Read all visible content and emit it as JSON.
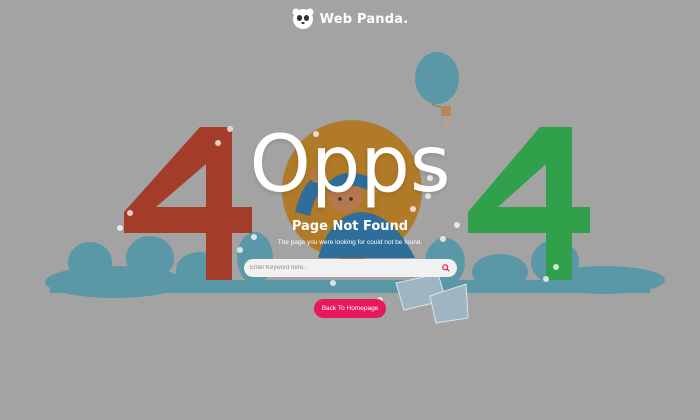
{
  "brand": {
    "name": "Web Panda."
  },
  "hero": {
    "headline": "Opps"
  },
  "error": {
    "title": "Page Not Found",
    "message": "The page you were looking for could not be found."
  },
  "search": {
    "placeholder": "Enter Keyword here.."
  },
  "actions": {
    "home_label": "Back To Homepage"
  },
  "colors": {
    "background": "#a3a3a3",
    "four_left": "#a43c2a",
    "four_right": "#31a04a",
    "zero_circle": "#b07a28",
    "bushes": "#5b98a7",
    "accent_button": "#e8185c"
  },
  "icons": [
    "panda-logo-icon",
    "search-icon",
    "hot-air-balloon",
    "paw-print"
  ]
}
